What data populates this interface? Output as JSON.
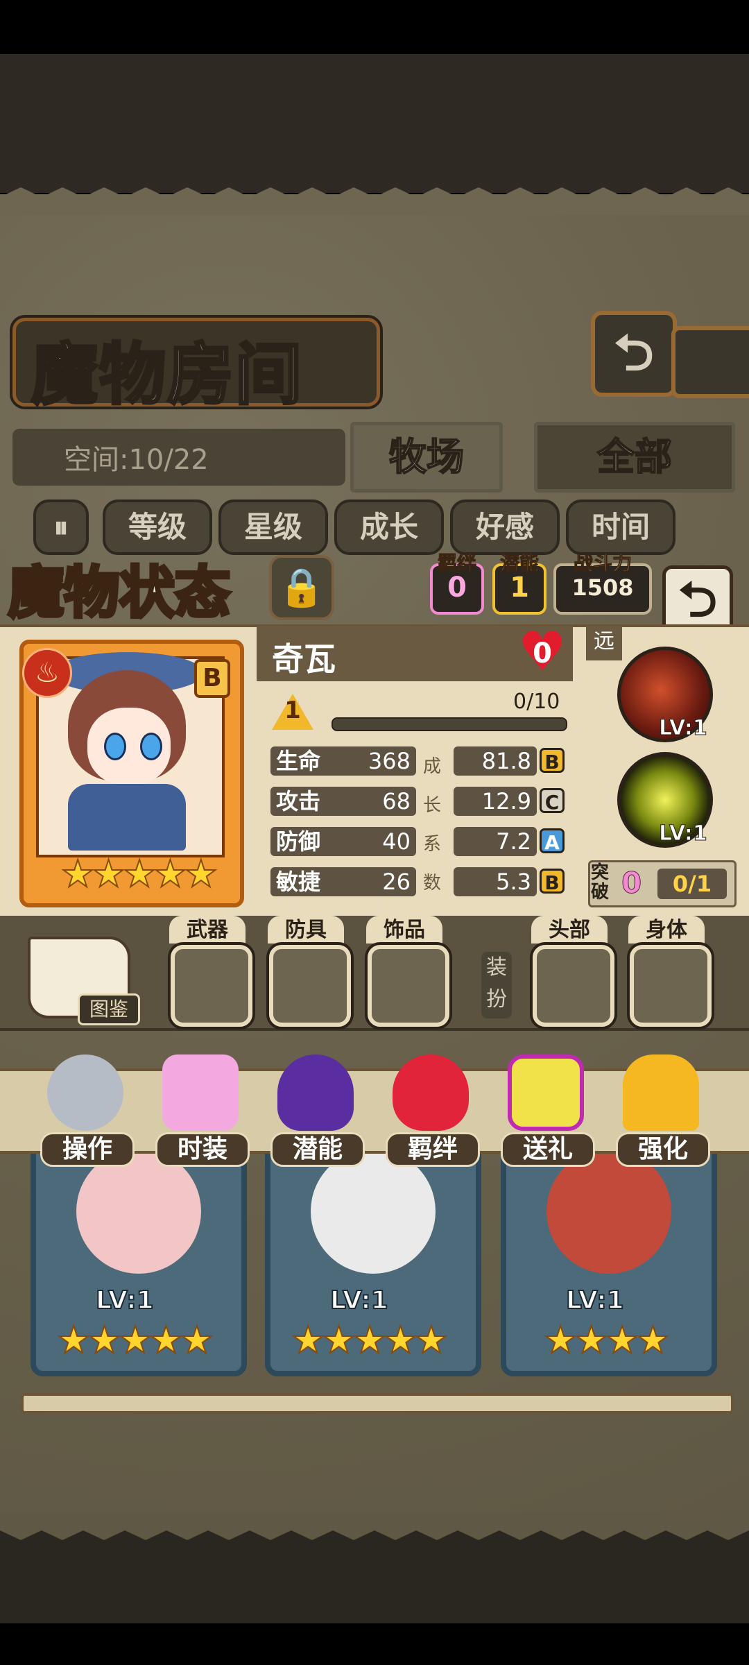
{
  "header": {
    "title": "魔物房间",
    "back_icon": "return-arrow-icon"
  },
  "room": {
    "space_text": "空间:10/22",
    "tabs": [
      {
        "label": "牧场"
      },
      {
        "label": "全部"
      }
    ]
  },
  "sort_bar": {
    "toggle_icon": "sort-order-icon",
    "items": [
      {
        "label": "等级"
      },
      {
        "label": "星级"
      },
      {
        "label": "成长"
      },
      {
        "label": "好感"
      },
      {
        "label": "时间"
      }
    ]
  },
  "status": {
    "title": "魔物状态",
    "lock_icon": "padlock-icon",
    "bond_label": "羁绊",
    "bond_value": "0",
    "potential_label": "潜能",
    "potential_value": "1",
    "power_label": "战斗力",
    "power_value": "1508",
    "back_icon": "return-arrow-icon"
  },
  "monster": {
    "name": "奇瓦",
    "element_icon": "fire-icon",
    "rank": "B",
    "stars": 5,
    "affection": "0",
    "level": "1",
    "exp": "0/10",
    "exp_fraction": 0,
    "growth_side_label": [
      "成",
      "长",
      "系",
      "数"
    ],
    "stats": [
      {
        "label": "生命",
        "value": "368",
        "growth": "81.8",
        "grade": "B"
      },
      {
        "label": "攻击",
        "value": "68",
        "growth": "12.9",
        "grade": "C"
      },
      {
        "label": "防御",
        "value": "40",
        "growth": "7.2",
        "grade": "A"
      },
      {
        "label": "敏捷",
        "value": "26",
        "growth": "5.3",
        "grade": "B"
      }
    ],
    "range": "远",
    "skills": [
      {
        "icon": "dark-flame-skill-icon",
        "level": "LV:1"
      },
      {
        "icon": "yellow-burst-skill-icon",
        "level": "LV:1"
      }
    ],
    "breakthrough_label": "突破",
    "breakthrough_value": "0",
    "breakthrough_progress": "0/1"
  },
  "equipment": {
    "book_label": "图鉴",
    "slots": [
      {
        "label": "武器"
      },
      {
        "label": "防具"
      },
      {
        "label": "饰品"
      },
      {
        "label": "头部"
      },
      {
        "label": "身体"
      }
    ],
    "dress_label": "装扮"
  },
  "actions": [
    {
      "label": "操作",
      "icon": "gear-icon"
    },
    {
      "label": "时装",
      "icon": "outfit-icon"
    },
    {
      "label": "潜能",
      "icon": "demon-silhouette-icon"
    },
    {
      "label": "羁绊",
      "icon": "hearts-icon"
    },
    {
      "label": "送礼",
      "icon": "gift-box-icon"
    },
    {
      "label": "强化",
      "icon": "upgrade-arrows-icon"
    }
  ],
  "cards": [
    {
      "level": "LV:1",
      "stars": 5
    },
    {
      "level": "LV:1",
      "stars": 5
    },
    {
      "level": "LV:1",
      "stars": 4
    }
  ],
  "colors": {
    "accent": "#9a6a34",
    "bond": "#f28ad0",
    "potential": "#f1c230",
    "panel": "#e8dcbc"
  }
}
